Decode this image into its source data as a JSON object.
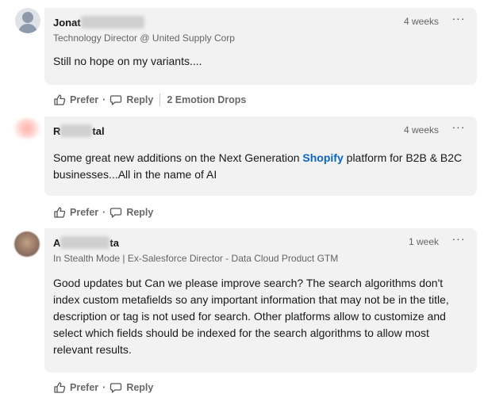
{
  "comments": [
    {
      "author_visible": "Jonat",
      "headline": "Technology Director @ United Supply Corp",
      "time": "4 weeks",
      "more": "···",
      "text": "Still no hope on my variants....",
      "actions": {
        "prefer": "Prefer",
        "reply": "Reply",
        "reactions": "2 Emotion Drops"
      }
    },
    {
      "author_visible_start": "R",
      "author_visible_end": "tal",
      "time": "4 weeks",
      "more": "···",
      "text_before": "Some great new additions on the Next Generation ",
      "mention": "Shopify",
      "text_after": " platform for B2B & B2C businesses...All in the name of AI",
      "actions": {
        "prefer": "Prefer",
        "reply": "Reply"
      }
    },
    {
      "author_visible_start": "A",
      "author_visible_end": "ta",
      "headline": "In Stealth Mode | Ex-Salesforce Director - Data Cloud Product GTM",
      "time": "1 week",
      "more": "···",
      "text": "Good updates but Can we please improve search? The search algorithms don't index custom metafields so any important information that may not be in the title, description or tag is not used for search. Other platforms allow to customize and select which fields should be indexed for the search algorithms to allow most relevant results.",
      "actions": {
        "prefer": "Prefer",
        "reply": "Reply"
      }
    }
  ],
  "separator": "·",
  "colors": {
    "mention": "#0a66c2",
    "bubble": "#f2f2f2"
  }
}
